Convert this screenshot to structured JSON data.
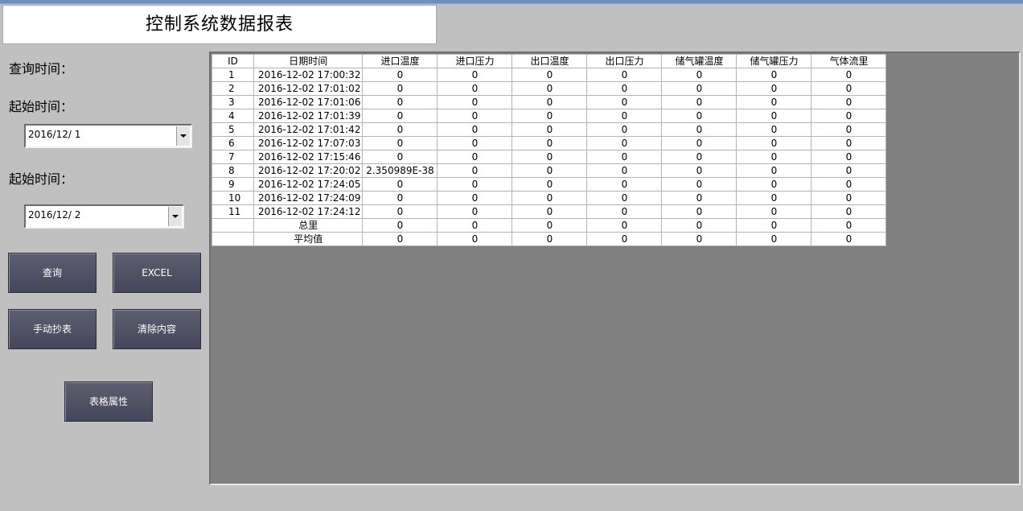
{
  "title": "控制系统数据报表",
  "labels": {
    "query_time": "查询时间：",
    "start_time_1": "起始时间：",
    "start_time_2": "起始时间："
  },
  "date_from": "2016/12/ 1",
  "date_to": "2016/12/ 2",
  "buttons": {
    "query": "查询",
    "excel": "EXCEL",
    "manual": "手动抄表",
    "clear": "清除内容",
    "props": "表格属性"
  },
  "table": {
    "columns": [
      "ID",
      "日期时间",
      "进口温度",
      "进口压力",
      "出口温度",
      "出口压力",
      "储气罐温度",
      "储气罐压力",
      "气体流里"
    ],
    "rows": [
      [
        "1",
        "2016-12-02 17:00:32",
        "0",
        "0",
        "0",
        "0",
        "0",
        "0",
        "0"
      ],
      [
        "2",
        "2016-12-02 17:01:02",
        "0",
        "0",
        "0",
        "0",
        "0",
        "0",
        "0"
      ],
      [
        "3",
        "2016-12-02 17:01:06",
        "0",
        "0",
        "0",
        "0",
        "0",
        "0",
        "0"
      ],
      [
        "4",
        "2016-12-02 17:01:39",
        "0",
        "0",
        "0",
        "0",
        "0",
        "0",
        "0"
      ],
      [
        "5",
        "2016-12-02 17:01:42",
        "0",
        "0",
        "0",
        "0",
        "0",
        "0",
        "0"
      ],
      [
        "6",
        "2016-12-02 17:07:03",
        "0",
        "0",
        "0",
        "0",
        "0",
        "0",
        "0"
      ],
      [
        "7",
        "2016-12-02 17:15:46",
        "0",
        "0",
        "0",
        "0",
        "0",
        "0",
        "0"
      ],
      [
        "8",
        "2016-12-02 17:20:02",
        "2.350989E-38",
        "0",
        "0",
        "0",
        "0",
        "0",
        "0"
      ],
      [
        "9",
        "2016-12-02 17:24:05",
        "0",
        "0",
        "0",
        "0",
        "0",
        "0",
        "0"
      ],
      [
        "10",
        "2016-12-02 17:24:09",
        "0",
        "0",
        "0",
        "0",
        "0",
        "0",
        "0"
      ],
      [
        "11",
        "2016-12-02 17:24:12",
        "0",
        "0",
        "0",
        "0",
        "0",
        "0",
        "0"
      ],
      [
        "",
        "总里",
        "0",
        "0",
        "0",
        "0",
        "0",
        "0",
        "0"
      ],
      [
        "",
        "平均值",
        "0",
        "0",
        "0",
        "0",
        "0",
        "0",
        "0"
      ]
    ]
  }
}
